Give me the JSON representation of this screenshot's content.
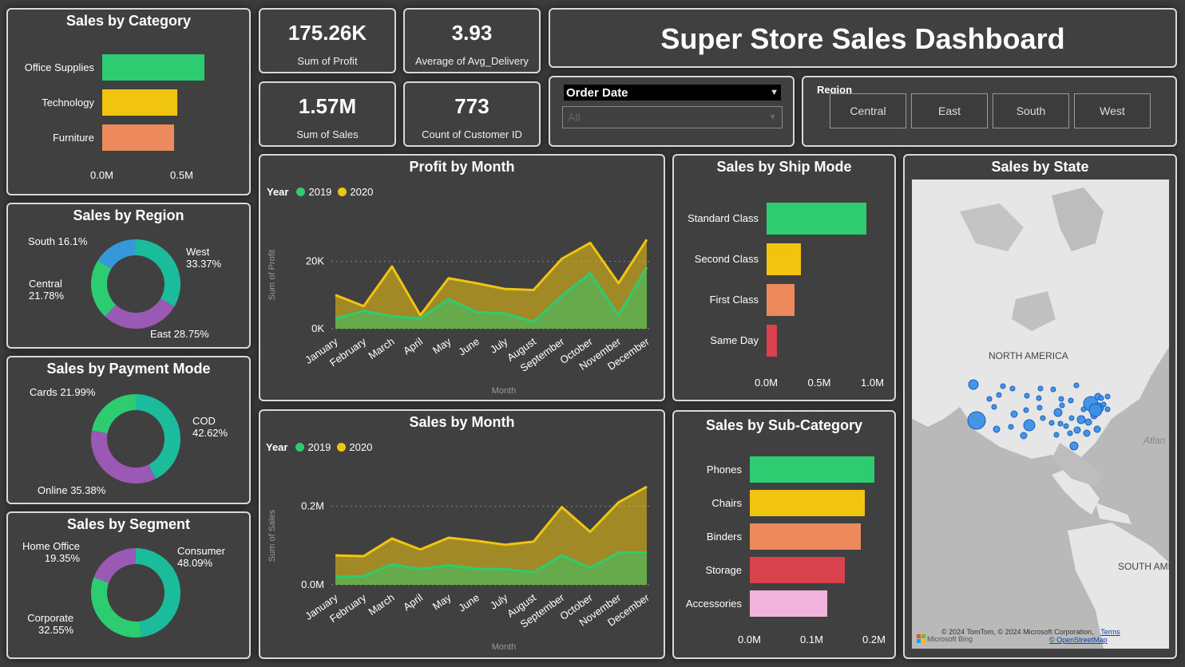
{
  "title": "Super Store Sales Dashboard",
  "kpis": {
    "profit": {
      "value": "175.26K",
      "label": "Sum of Profit"
    },
    "delivery": {
      "value": "3.93",
      "label": "Average of Avg_Delivery"
    },
    "sales": {
      "value": "1.57M",
      "label": "Sum of Sales"
    },
    "customers": {
      "value": "773",
      "label": "Count of Customer ID"
    }
  },
  "filters": {
    "order_date": {
      "label": "Order Date",
      "value": "All"
    },
    "region": {
      "label": "Region",
      "options": [
        "Central",
        "East",
        "South",
        "West"
      ]
    }
  },
  "colors": {
    "green": "#2ecc71",
    "yellow": "#f1c40f",
    "orange": "#ec8a5e",
    "red": "#d9434e",
    "pink": "#f2b3dc",
    "teal": "#1abc9c",
    "purple": "#9b59b6",
    "blue": "#3498db"
  },
  "chart_data": [
    {
      "id": "category",
      "type": "bar",
      "orientation": "horizontal",
      "title": "Sales by Category",
      "categories": [
        "Office Supplies",
        "Technology",
        "Furniture"
      ],
      "values": [
        0.64,
        0.47,
        0.45
      ],
      "colors": [
        "#2ecc71",
        "#f1c40f",
        "#ec8a5e"
      ],
      "xlim": [
        0,
        0.5
      ],
      "ticks": [
        "0.0M",
        "0.5M"
      ]
    },
    {
      "id": "region",
      "type": "pie",
      "donut": true,
      "title": "Sales by Region",
      "labels": [
        "West",
        "East",
        "Central",
        "South"
      ],
      "values": [
        33.37,
        28.75,
        21.78,
        16.1
      ],
      "value_labels": [
        "33.37%",
        "28.75%",
        "21.78%",
        "16.1%"
      ],
      "colors": [
        "#1abc9c",
        "#9b59b6",
        "#2ecc71",
        "#3498db"
      ]
    },
    {
      "id": "payment",
      "type": "pie",
      "donut": true,
      "title": "Sales by Payment Mode",
      "labels": [
        "COD",
        "Online",
        "Cards"
      ],
      "values": [
        42.62,
        35.38,
        21.99
      ],
      "value_labels": [
        "42.62%",
        "35.38%",
        "21.99%"
      ],
      "colors": [
        "#1abc9c",
        "#9b59b6",
        "#2ecc71"
      ]
    },
    {
      "id": "segment",
      "type": "pie",
      "donut": true,
      "title": "Sales by Segment",
      "labels": [
        "Consumer",
        "Corporate",
        "Home Office"
      ],
      "values": [
        48.09,
        32.55,
        19.35
      ],
      "value_labels": [
        "48.09%",
        "32.55%",
        "19.35%"
      ],
      "colors": [
        "#1abc9c",
        "#2ecc71",
        "#9b59b6"
      ]
    },
    {
      "id": "profit_month",
      "type": "area",
      "title": "Profit by Month",
      "xlabel": "Month",
      "ylabel": "Sum of Profit",
      "legend_title": "Year",
      "categories": [
        "January",
        "February",
        "March",
        "April",
        "May",
        "June",
        "July",
        "August",
        "September",
        "October",
        "November",
        "December"
      ],
      "series": [
        {
          "name": "2019",
          "color": "#2ecc71",
          "values": [
            3000,
            5300,
            3700,
            3000,
            8800,
            4900,
            4500,
            2000,
            9800,
            16500,
            4000,
            18200
          ]
        },
        {
          "name": "2020",
          "color": "#f1c40f",
          "values": [
            10000,
            6700,
            18500,
            4000,
            15000,
            13500,
            11800,
            11500,
            20800,
            25500,
            13500,
            26500
          ]
        }
      ],
      "ylim": [
        0,
        32000
      ],
      "ticks": [
        {
          "v": 0,
          "label": "0K"
        },
        {
          "v": 20000,
          "label": "20K"
        }
      ]
    },
    {
      "id": "sales_month",
      "type": "area",
      "title": "Sales by Month",
      "xlabel": "Month",
      "ylabel": "Sum of Sales",
      "legend_title": "Year",
      "categories": [
        "January",
        "February",
        "March",
        "April",
        "May",
        "June",
        "July",
        "August",
        "September",
        "October",
        "November",
        "December"
      ],
      "series": [
        {
          "name": "2019",
          "color": "#2ecc71",
          "values": [
            0.02,
            0.022,
            0.052,
            0.04,
            0.05,
            0.041,
            0.04,
            0.032,
            0.075,
            0.043,
            0.082,
            0.082
          ]
        },
        {
          "name": "2020",
          "color": "#f1c40f",
          "values": [
            0.075,
            0.073,
            0.118,
            0.09,
            0.12,
            0.112,
            0.102,
            0.11,
            0.198,
            0.135,
            0.21,
            0.25
          ]
        }
      ],
      "ylim": [
        0,
        0.25
      ],
      "ticks": [
        {
          "v": 0,
          "label": "0.0M"
        },
        {
          "v": 0.2,
          "label": "0.2M"
        }
      ]
    },
    {
      "id": "ship_mode",
      "type": "bar",
      "orientation": "horizontal",
      "title": "Sales by Ship Mode",
      "categories": [
        "Standard Class",
        "Second Class",
        "First Class",
        "Same Day"
      ],
      "values": [
        0.94,
        0.32,
        0.26,
        0.1
      ],
      "colors": [
        "#2ecc71",
        "#f1c40f",
        "#ec8a5e",
        "#d9434e"
      ],
      "xlim": [
        0,
        1.0
      ],
      "ticks": [
        "0.0M",
        "0.5M",
        "1.0M"
      ]
    },
    {
      "id": "sub_category",
      "type": "bar",
      "orientation": "horizontal",
      "title": "Sales by Sub-Category",
      "categories": [
        "Phones",
        "Chairs",
        "Binders",
        "Storage",
        "Accessories"
      ],
      "values": [
        0.2,
        0.185,
        0.178,
        0.152,
        0.124
      ],
      "colors": [
        "#2ecc71",
        "#f1c40f",
        "#ec8a5e",
        "#d9434e",
        "#f2b3dc"
      ],
      "xlim": [
        0,
        0.2
      ],
      "ticks": [
        "0.0M",
        "0.1M",
        "0.2M"
      ]
    }
  ],
  "map": {
    "title": "Sales by State",
    "labels": {
      "na": "NORTH AMERICA",
      "sa": "SOUTH AME",
      "atl": "Atlan"
    },
    "attribution": "© 2024 TomTom, © 2024 Microsoft Corporation,",
    "terms": "Terms",
    "osm": "© OpenStreetMap",
    "bing": "Microsoft Bing"
  }
}
